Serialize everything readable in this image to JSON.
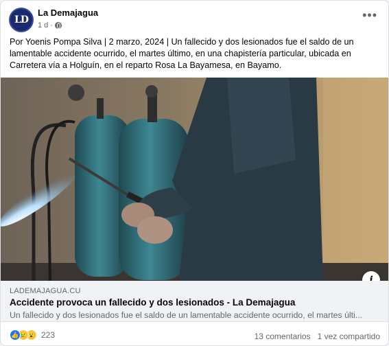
{
  "post": {
    "page_name": "La Demajagua",
    "avatar_text": "LD",
    "time": "1 d",
    "text": "Por Yoenis Pompa Silva | 2 marzo, 2024 | Un fallecido y dos lesionados fue el saldo de un lamentable accidente ocurrido, el martes último, en una chapistería particular, ubicada en Carretera vía a Holguín, en el reparto Rosa La Bayamesa, en Bayamo."
  },
  "link": {
    "domain": "LADEMAJAGUA.CU",
    "title": "Accidente provoca un fallecido y dos lesionados - La Demajagua",
    "description": "Un fallecido y dos lesionados fue el saldo de un lamentable accidente ocurrido, el martes últi..."
  },
  "footer": {
    "reaction_icons": [
      "like-icon",
      "sad-icon",
      "wow-icon"
    ],
    "reaction_count": "223",
    "comments": "13 comentarios",
    "shares": "1 vez compartido"
  },
  "colors": {
    "accent": "#1877f2",
    "link_bg": "#f0f2f5",
    "meta_text": "#65676b"
  }
}
